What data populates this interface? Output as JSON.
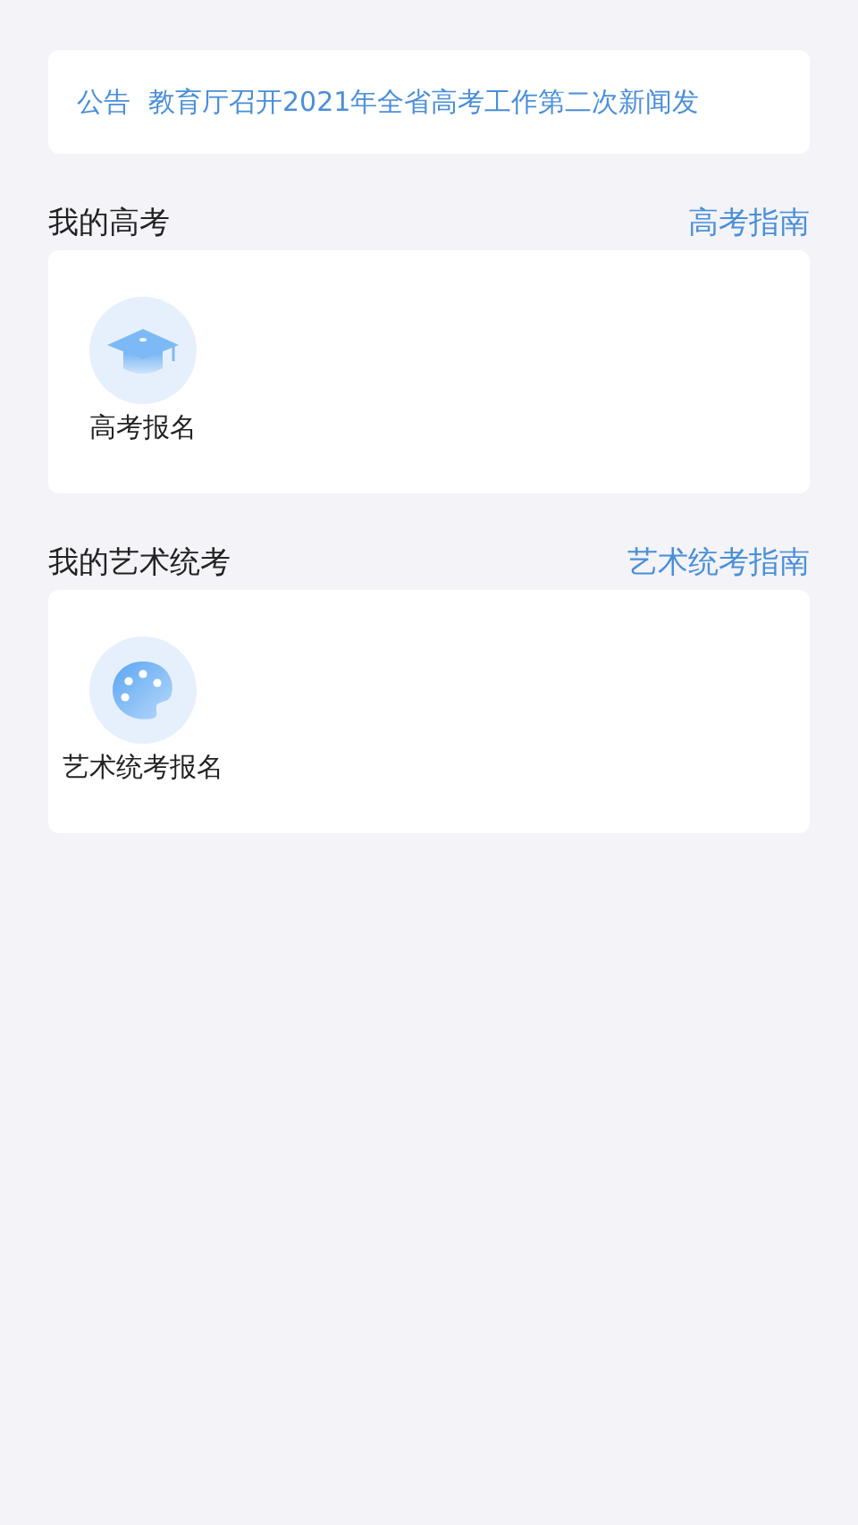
{
  "notice": {
    "tag": "公告",
    "text": "教育厅召开2021年全省高考工作第二次新闻发"
  },
  "sections": [
    {
      "title": "我的高考",
      "guide": "高考指南",
      "items": [
        {
          "kind": "cap",
          "label": "高考报名"
        }
      ]
    },
    {
      "title": "我的艺术统考",
      "guide": "艺术统考指南",
      "items": [
        {
          "kind": "palette",
          "label": "艺术统考报名"
        }
      ]
    }
  ]
}
